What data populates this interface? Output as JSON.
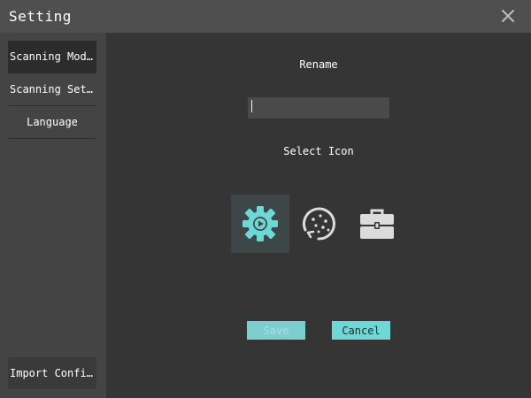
{
  "window": {
    "title": "Setting"
  },
  "sidebar": {
    "items": [
      {
        "label": "Scanning Model",
        "active": true
      },
      {
        "label": "Scanning Set…",
        "active": false
      },
      {
        "label": "Language",
        "active": false
      }
    ],
    "bottom_item": {
      "label": "Import Confi…"
    }
  },
  "form": {
    "rename_label": "Rename",
    "rename_value": "",
    "select_icon_label": "Select Icon",
    "icons": [
      {
        "name": "gear-play-icon",
        "selected": true
      },
      {
        "name": "dotted-circle-icon",
        "selected": false
      },
      {
        "name": "toolbox-icon",
        "selected": false
      }
    ],
    "save_label": "Save",
    "cancel_label": "Cancel"
  },
  "colors": {
    "accent": "#6ed8d7",
    "titlebar": "#4f4f4f",
    "sidebar": "#444444",
    "background": "#353535"
  }
}
